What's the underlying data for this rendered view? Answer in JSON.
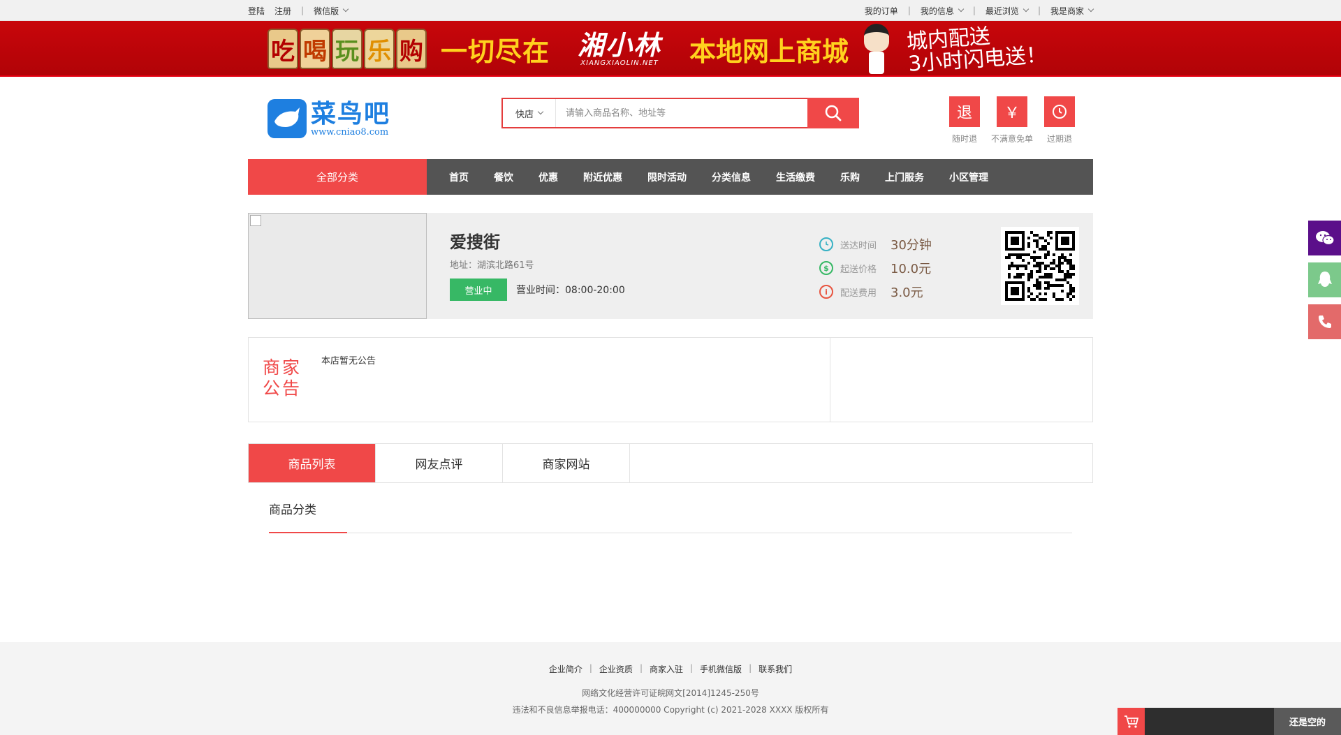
{
  "topbar": {
    "login": "登陆",
    "register": "注册",
    "wechat_version": "微信版",
    "my_orders": "我的订单",
    "my_info": "我的信息",
    "recent": "最近浏览",
    "i_am_merchant": "我是商家"
  },
  "banner": {
    "tags": [
      "吃",
      "喝",
      "玩",
      "乐",
      "购"
    ],
    "slogan_left": "一切尽在",
    "brand": "湘小林",
    "brand_url": "XIANGXIAOLIN.NET",
    "slogan_right": "本地网上商城",
    "delivery_line1": "城内配送",
    "delivery_line2": "3小时闪电送！"
  },
  "header": {
    "logo_cn": "菜鸟吧",
    "logo_url": "www.cniao8.com",
    "search_type": "快店",
    "search_placeholder": "请输入商品名称、地址等",
    "promises": [
      {
        "icon": "退",
        "label": "随时退"
      },
      {
        "icon": "￥",
        "label": "不满意免单"
      },
      {
        "icon": "clock",
        "label": "过期退"
      }
    ]
  },
  "nav": {
    "all_categories": "全部分类",
    "items": [
      "首页",
      "餐饮",
      "优惠",
      "附近优惠",
      "限时活动",
      "分类信息",
      "生活缴费",
      "乐购",
      "上门服务",
      "小区管理"
    ]
  },
  "shop": {
    "name": "爱搜街",
    "address": "地址：湖滨北路61号",
    "status": "营业中",
    "hours": "营业时间：08:00-20:00",
    "stats": [
      {
        "label": "送达时间",
        "value": "30分钟",
        "color": "#37b1c4"
      },
      {
        "label": "起送价格",
        "value": "10.0元",
        "color": "#37b865"
      },
      {
        "label": "配送费用",
        "value": "3.0元",
        "color": "#e8543f"
      }
    ]
  },
  "notice": {
    "title": "商家公告",
    "text": "本店暂无公告"
  },
  "tabs": [
    "商品列表",
    "网友点评",
    "商家网站"
  ],
  "category_title": "商品分类",
  "footer": {
    "links": [
      "企业简介",
      "企业资质",
      "商家入驻",
      "手机微信版",
      "联系我们"
    ],
    "license": "网络文化经营许可证皖网文[2014]1245-250号",
    "copyright": "违法和不良信息举报电话：400000000 Copyright (c) 2021-2028 XXXX 版权所有"
  },
  "cart": {
    "empty_text": "还是空的"
  },
  "colors": {
    "accent": "#f04848",
    "nav_bg": "#545454",
    "open_green": "#37b865",
    "wechat_purple": "#5b0f8a",
    "qq_green": "#7cc98b",
    "phone_red": "#e36a6a"
  }
}
